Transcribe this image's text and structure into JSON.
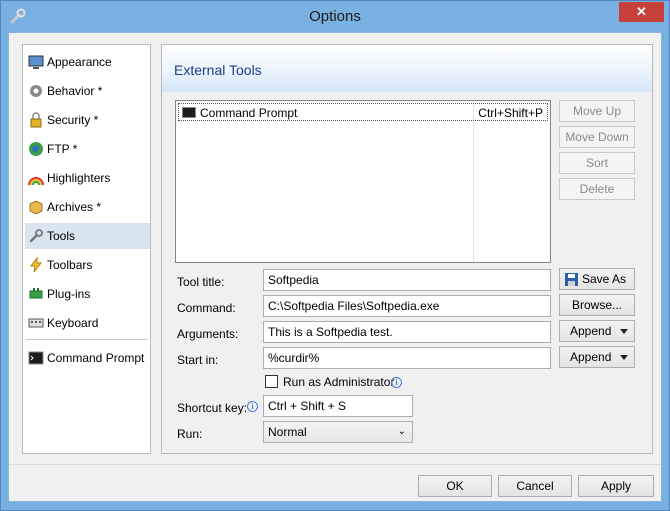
{
  "window": {
    "title": "Options",
    "close_glyph": "✕"
  },
  "sidebar": {
    "items": [
      {
        "label": "Appearance",
        "icon": "monitor-icon"
      },
      {
        "label": "Behavior *",
        "icon": "gear-icon"
      },
      {
        "label": "Security *",
        "icon": "lock-icon"
      },
      {
        "label": "FTP *",
        "icon": "globe-icon"
      },
      {
        "label": "Highlighters",
        "icon": "rainbow-icon"
      },
      {
        "label": "Archives *",
        "icon": "package-icon"
      },
      {
        "label": "Tools",
        "icon": "wrench-icon",
        "selected": true
      },
      {
        "label": "Toolbars",
        "icon": "lightning-icon"
      },
      {
        "label": "Plug-ins",
        "icon": "plugin-icon"
      },
      {
        "label": "Keyboard",
        "icon": "keyboard-icon"
      }
    ],
    "extra_item": {
      "label": "Command Prompt",
      "icon": "console-icon"
    }
  },
  "panel": {
    "title": "External Tools",
    "tools": [
      {
        "name": "Command Prompt",
        "shortcut": "Ctrl+Shift+P"
      }
    ],
    "list_buttons": {
      "move_up": "Move Up",
      "move_down": "Move Down",
      "sort": "Sort",
      "delete": "Delete"
    },
    "form": {
      "tool_title_label": "Tool title:",
      "tool_title_value": "Softpedia",
      "save_as_label": "Save As",
      "command_label": "Command:",
      "command_value": "C:\\Softpedia Files\\Softpedia.exe",
      "browse_label": "Browse...",
      "arguments_label": "Arguments:",
      "arguments_value": "This is a Softpedia test.",
      "append_label": "Append",
      "start_in_label": "Start in:",
      "start_in_value": "%curdir%",
      "run_as_admin_label": "Run as Administrator",
      "run_as_admin_checked": false,
      "shortcut_label": "Shortcut key:",
      "shortcut_value": "Ctrl + Shift + S",
      "run_label": "Run:",
      "run_value": "Normal"
    }
  },
  "footer": {
    "ok": "OK",
    "cancel": "Cancel",
    "apply": "Apply"
  },
  "colors": {
    "title_bar": "#79b0e2",
    "close": "#c7413b",
    "header_text": "#1b3c8a",
    "selection": "#d9e4f1"
  }
}
